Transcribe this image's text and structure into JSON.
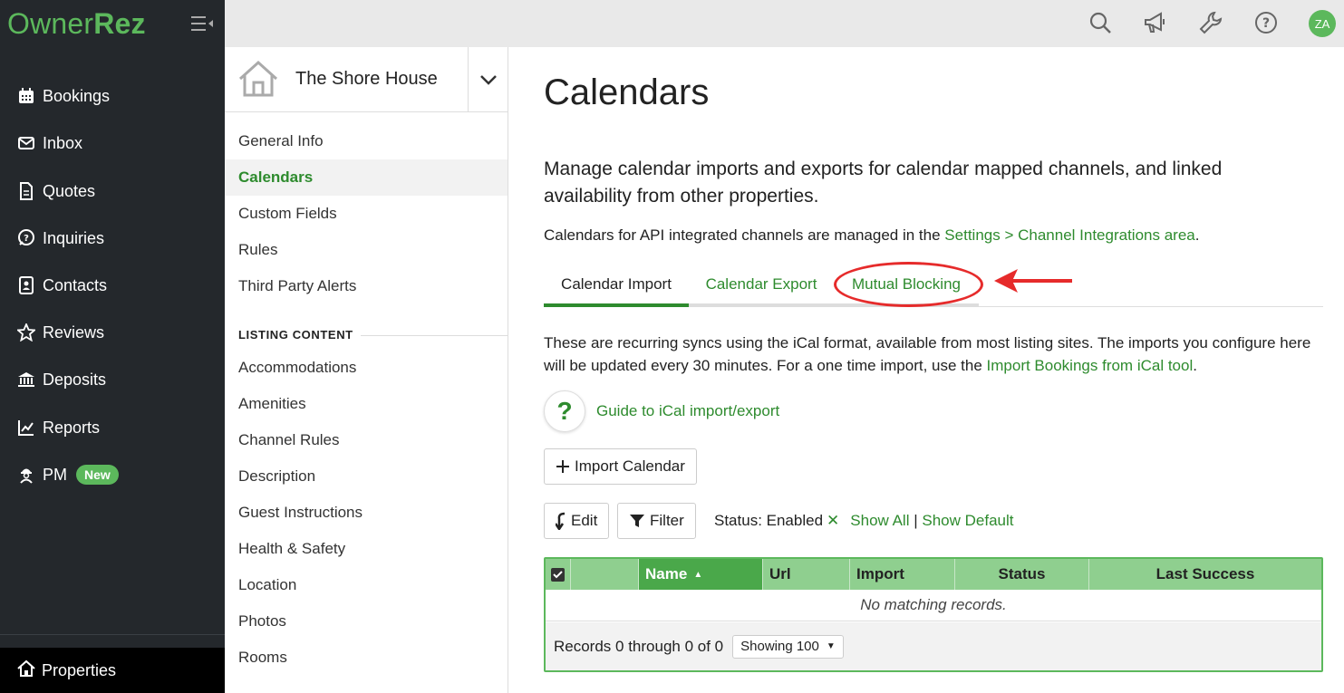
{
  "app": {
    "logo_owner": "Owner",
    "logo_rez": "Rez"
  },
  "sidebar": {
    "items": [
      {
        "label": "Bookings",
        "icon": "calendar-icon"
      },
      {
        "label": "Inbox",
        "icon": "envelope-icon"
      },
      {
        "label": "Quotes",
        "icon": "document-icon"
      },
      {
        "label": "Inquiries",
        "icon": "question-bubble-icon"
      },
      {
        "label": "Contacts",
        "icon": "contact-card-icon"
      },
      {
        "label": "Reviews",
        "icon": "star-icon"
      },
      {
        "label": "Deposits",
        "icon": "bank-icon"
      },
      {
        "label": "Reports",
        "icon": "line-chart-icon"
      },
      {
        "label": "PM",
        "icon": "worker-icon",
        "badge": "New"
      }
    ],
    "properties_label": "Properties"
  },
  "topbar": {
    "icons": [
      "search-icon",
      "megaphone-icon",
      "wrench-icon",
      "help-icon"
    ],
    "avatar_initials": "ZA"
  },
  "property_panel": {
    "property_name": "The Shore House",
    "items": [
      "General Info",
      "Calendars",
      "Custom Fields",
      "Rules",
      "Third Party Alerts"
    ],
    "active_item": "Calendars",
    "listing_content_heading": "LISTING CONTENT",
    "listing_items": [
      "Accommodations",
      "Amenities",
      "Channel Rules",
      "Description",
      "Guest Instructions",
      "Health & Safety",
      "Location",
      "Photos",
      "Rooms"
    ]
  },
  "main": {
    "title": "Calendars",
    "intro": "Manage calendar imports and exports for calendar mapped channels, and linked availability from other properties.",
    "api_note_prefix": "Calendars for API integrated channels are managed in the ",
    "api_note_link": "Settings > Channel Integrations area",
    "api_note_suffix": ".",
    "tabs": [
      {
        "label": "Calendar Import",
        "active": true
      },
      {
        "label": "Calendar Export",
        "active": false
      },
      {
        "label": "Mutual Blocking",
        "active": false
      }
    ],
    "sync_note_prefix": "These are recurring syncs using the iCal format, available from most listing sites. The imports you configure here will be updated every 30 minutes. For a one time import, use the ",
    "sync_note_link": "Import Bookings from iCal tool",
    "sync_note_suffix": ".",
    "guide_symbol": "?",
    "guide_link": "Guide to iCal import/export",
    "import_button": "Import Calendar",
    "edit_button": "Edit",
    "filter_button": "Filter",
    "status_label": "Status: Enabled",
    "status_clear": "✕",
    "show_all": "Show All",
    "separator": "|",
    "show_default": "Show Default",
    "table": {
      "columns": [
        "Name",
        "Url",
        "Import",
        "Status",
        "Last Success"
      ],
      "sorted_column": "Name",
      "sort_arrow": "▲",
      "empty_message": "No matching records.",
      "records_text": "Records 0 through 0 of 0",
      "page_size": "Showing 100",
      "page_size_caret": "▼"
    }
  },
  "colors": {
    "brand_green": "#5cb85c",
    "link_green": "#2e8b2e",
    "sidebar_bg": "#24282c",
    "annotation_red": "#e62b2b"
  }
}
